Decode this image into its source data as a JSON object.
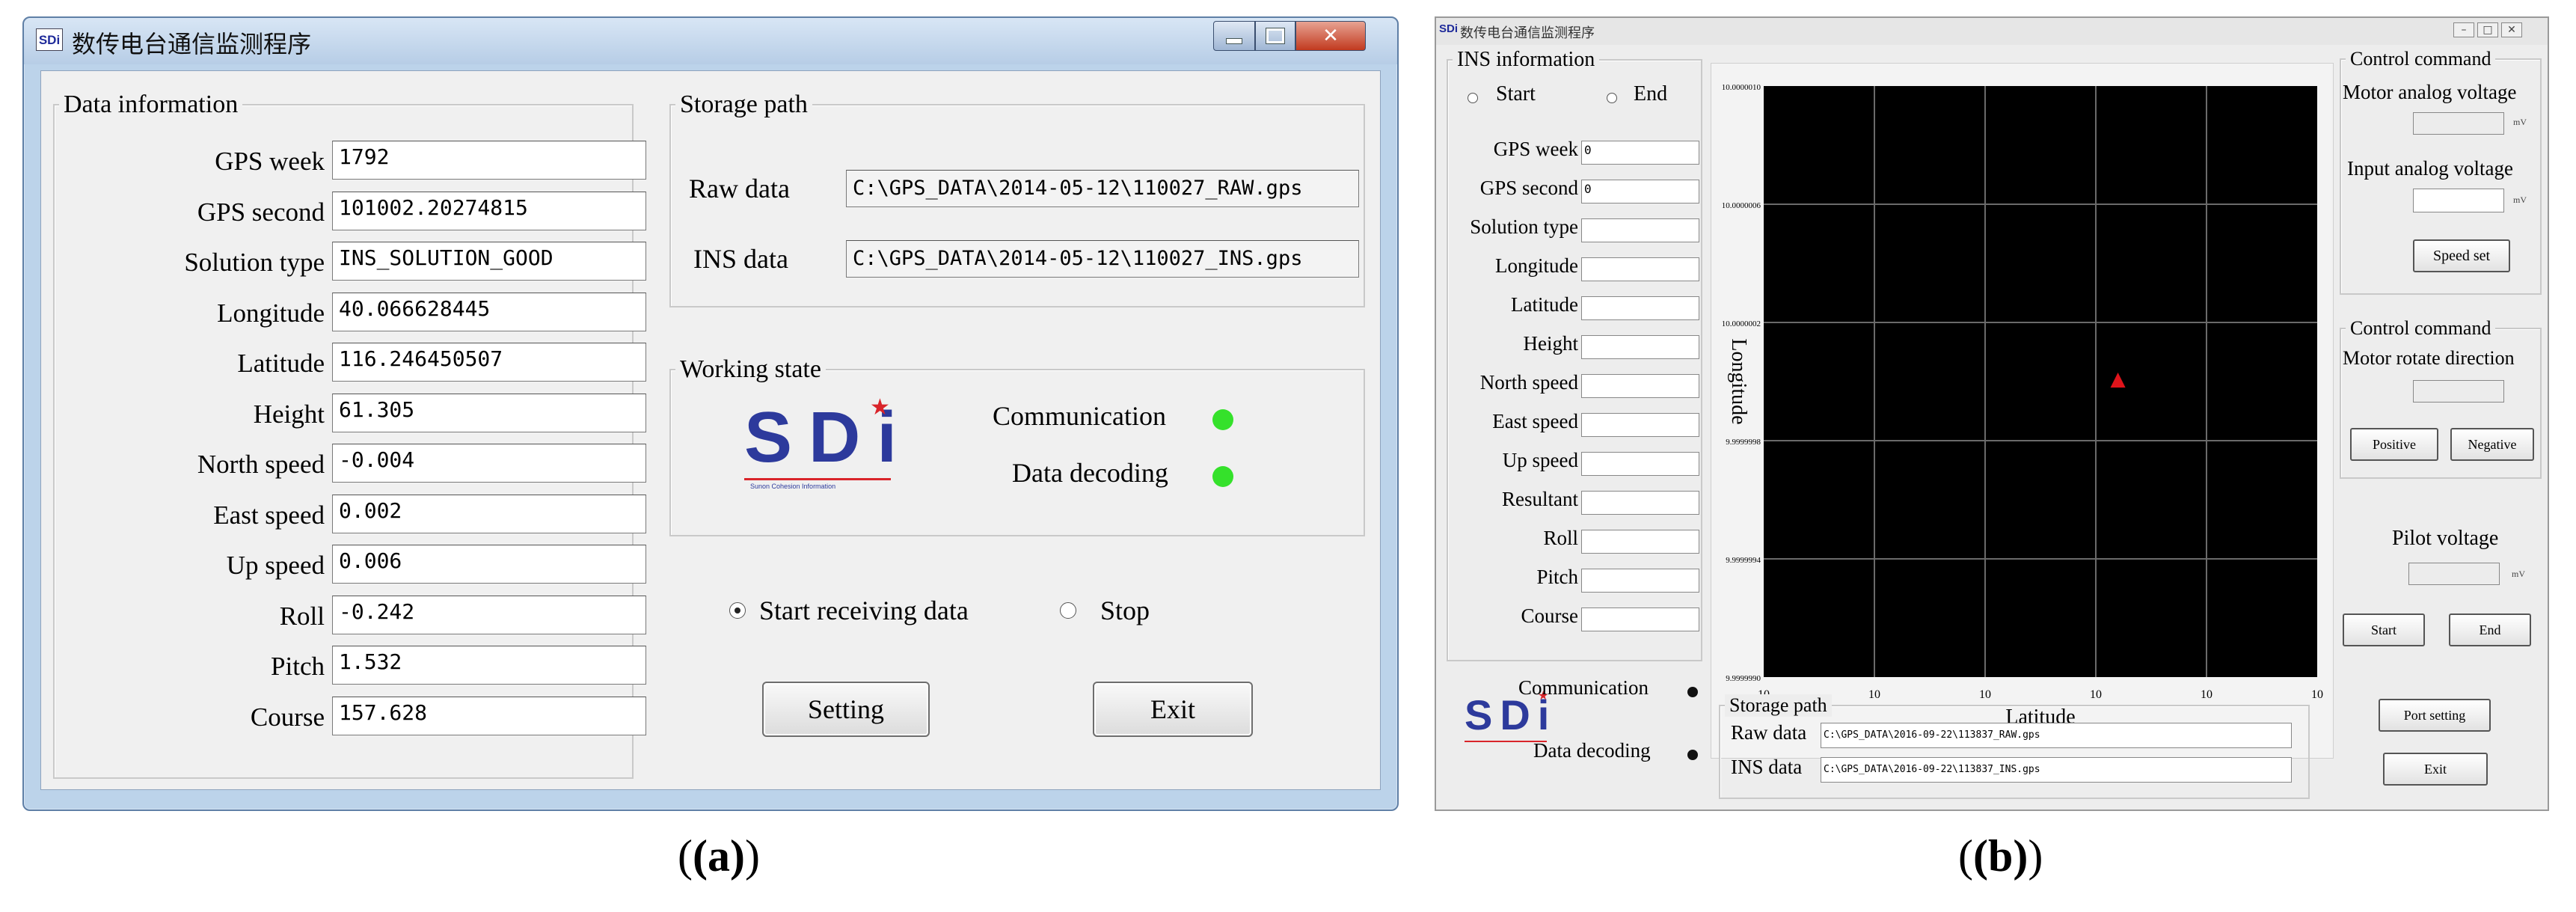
{
  "panel_a": {
    "title": "数传电台通信监测程序",
    "title_icon": "SDi",
    "data_information": {
      "legend": "Data information",
      "fields": [
        {
          "label": "GPS week",
          "value": "1792"
        },
        {
          "label": "GPS second",
          "value": "101002.20274815"
        },
        {
          "label": "Solution type",
          "value": "INS_SOLUTION_GOOD"
        },
        {
          "label": "Longitude",
          "value": "40.066628445"
        },
        {
          "label": "Latitude",
          "value": "116.246450507"
        },
        {
          "label": "Height",
          "value": "61.305"
        },
        {
          "label": "North speed",
          "value": "-0.004"
        },
        {
          "label": "East speed",
          "value": "0.002"
        },
        {
          "label": "Up speed",
          "value": "0.006"
        },
        {
          "label": "Roll",
          "value": "-0.242"
        },
        {
          "label": "Pitch",
          "value": "1.532"
        },
        {
          "label": "Course",
          "value": "157.628"
        }
      ]
    },
    "storage_path": {
      "legend": "Storage path",
      "raw_label": "Raw data",
      "raw_value": "C:\\GPS_DATA\\2014-05-12\\110027_RAW.gps",
      "ins_label": "INS data",
      "ins_value": "C:\\GPS_DATA\\2014-05-12\\110027_INS.gps"
    },
    "working_state": {
      "legend": "Working state",
      "logo_text": "SDi",
      "logo_tagline": "Sunon Cohesion Information",
      "communication_label": "Communication",
      "decoding_label": "Data decoding",
      "led_color": "#35e12b"
    },
    "receive_mode": {
      "start_label": "Start receiving data",
      "stop_label": "Stop",
      "selected": "start"
    },
    "buttons": {
      "setting": "Setting",
      "exit": "Exit"
    },
    "caption": "(a)"
  },
  "panel_b": {
    "title": "数传电台通信监测程序",
    "title_icon": "SDi",
    "ins_information": {
      "legend": "INS information",
      "start_label": "Start",
      "end_label": "End",
      "fields": [
        {
          "label": "GPS week",
          "value": "0"
        },
        {
          "label": "GPS second",
          "value": "0"
        },
        {
          "label": "Solution type",
          "value": ""
        },
        {
          "label": "Longitude",
          "value": ""
        },
        {
          "label": "Latitude",
          "value": ""
        },
        {
          "label": "Height",
          "value": ""
        },
        {
          "label": "North speed",
          "value": ""
        },
        {
          "label": "East speed",
          "value": ""
        },
        {
          "label": "Up speed",
          "value": ""
        },
        {
          "label": "Resultant",
          "value": ""
        },
        {
          "label": "Roll",
          "value": ""
        },
        {
          "label": "Pitch",
          "value": ""
        },
        {
          "label": "Course",
          "value": ""
        }
      ]
    },
    "chart_data": {
      "type": "scatter",
      "title": "",
      "xlabel": "Latitude",
      "ylabel": "Longitude",
      "x_ticks": [
        "10",
        "10",
        "10",
        "10",
        "10",
        "10"
      ],
      "y_ticks": [
        "10.0000010",
        "10.0000006",
        "10.0000002",
        "9.9999998",
        "9.9999994",
        "9.9999990"
      ],
      "xlim": [
        0,
        5
      ],
      "ylim": [
        9.999999,
        10.000001
      ],
      "grid": true,
      "background": "#000000",
      "grid_color": "#6a6a6a",
      "point_color": "#e0141b",
      "points": [
        {
          "x": 3.2,
          "y": 10.0
        }
      ]
    },
    "control_command_1": {
      "legend": "Control command",
      "motor_voltage_label": "Motor analog voltage",
      "motor_voltage_unit": "mV",
      "input_voltage_label": "Input analog voltage",
      "input_voltage_unit": "mV",
      "speed_set": "Speed set"
    },
    "control_command_2": {
      "legend": "Control command",
      "direction_label": "Motor rotate direction",
      "positive": "Positive",
      "negative": "Negative"
    },
    "pilot": {
      "label": "Pilot voltage",
      "unit": "mV",
      "start": "Start",
      "end": "End"
    },
    "status": {
      "communication_label": "Communication",
      "decoding_label": "Data decoding",
      "logo_text": "SDi"
    },
    "storage_path": {
      "legend": "Storage path",
      "raw_label": "Raw data",
      "raw_value": "C:\\GPS_DATA\\2016-09-22\\113837_RAW.gps",
      "ins_label": "INS data",
      "ins_value": "C:\\GPS_DATA\\2016-09-22\\113837_INS.gps"
    },
    "buttons": {
      "port_setting": "Port setting",
      "exit": "Exit"
    },
    "caption": "(b)"
  }
}
